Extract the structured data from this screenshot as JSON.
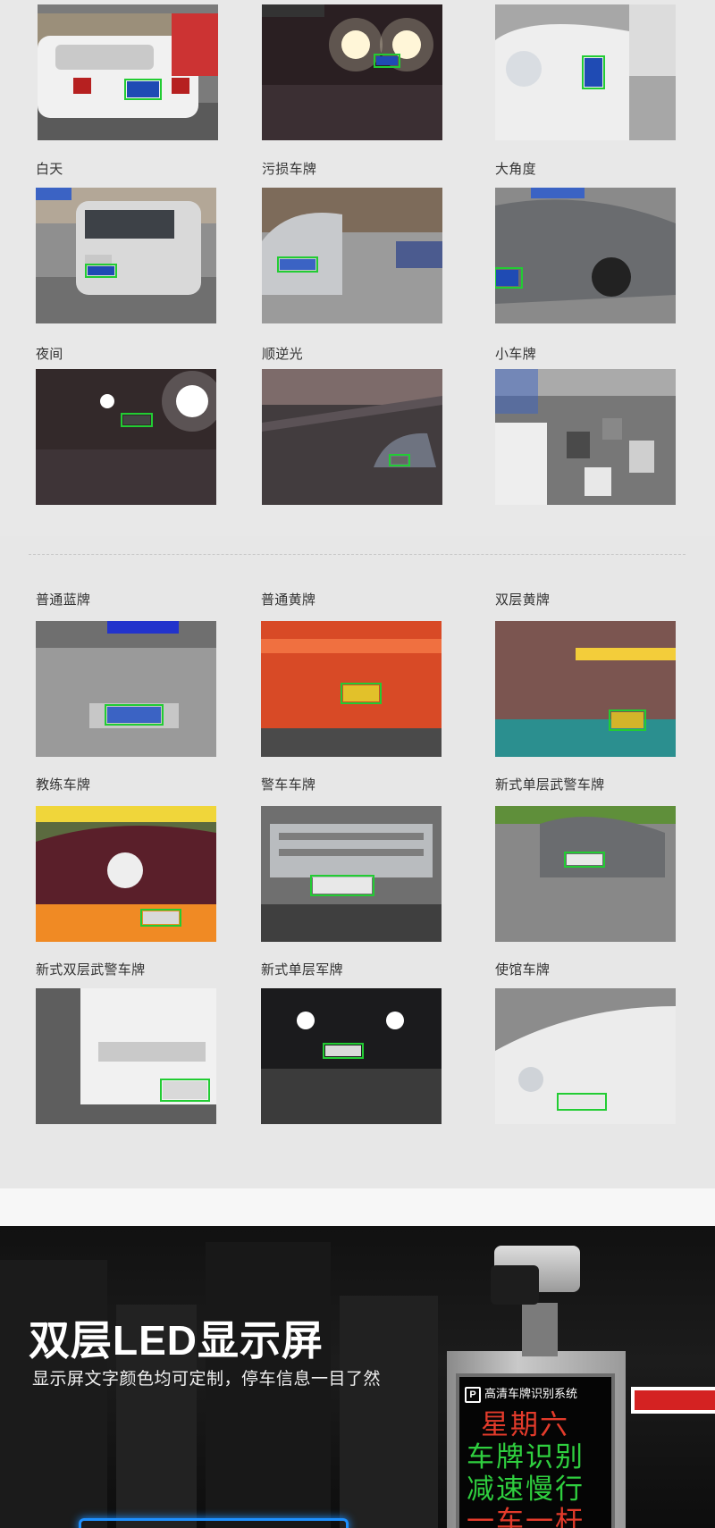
{
  "scenes": [
    {
      "label": "",
      "image": "white-sedan-rear-plate"
    },
    {
      "label": "",
      "image": "car-headlights-night-rain"
    },
    {
      "label": "",
      "image": "silver-hatchback-front-plate"
    },
    {
      "label": "白天",
      "image": "silver-minivan-daytime"
    },
    {
      "label": "污损车牌",
      "image": "silver-sedan-dirty-plate"
    },
    {
      "label": "大角度",
      "image": "gray-sedan-large-angle"
    },
    {
      "label": "夜间",
      "image": "night-glare-car"
    },
    {
      "label": "顺逆光",
      "image": "backlit-road-car"
    },
    {
      "label": "小车牌",
      "image": "traffic-jam-small-plates"
    }
  ],
  "plate_types": [
    {
      "label": "普通蓝牌",
      "image": "van-rear-blue-plate"
    },
    {
      "label": "普通黄牌",
      "image": "orange-truck-yellow-plate"
    },
    {
      "label": "双层黄牌",
      "image": "truck-double-layer-plate"
    },
    {
      "label": "教练车牌",
      "image": "driving-school-car"
    },
    {
      "label": "警车车牌",
      "image": "police-suv-grille"
    },
    {
      "label": "新式单层武警车牌",
      "image": "buick-armed-police-plate"
    },
    {
      "label": "新式双层武警车牌",
      "image": "isuzu-truck-double-plate"
    },
    {
      "label": "新式单层军牌",
      "image": "night-military-plate"
    },
    {
      "label": "使馆车牌",
      "image": "white-toyota-embassy-plate"
    }
  ],
  "led_promo": {
    "title": "双层LED显示屏",
    "subtitle": "显示屏文字颜色均可定制，停车信息一目了然",
    "screen_header": "高清车牌识别系统",
    "screen_logo": "P",
    "screen_lines": [
      {
        "text": "星期六",
        "color": "#e33b2b"
      },
      {
        "text": "车牌识别",
        "color": "#2fcf3f"
      },
      {
        "text": "减速慢行",
        "color": "#2fcf3f"
      },
      {
        "text": "一车一杆",
        "color": "#e33b2b"
      }
    ]
  },
  "colors": {
    "plate_box": "#22cc33",
    "accent_bar": "#1e90ff",
    "barrier": "#d42222"
  }
}
